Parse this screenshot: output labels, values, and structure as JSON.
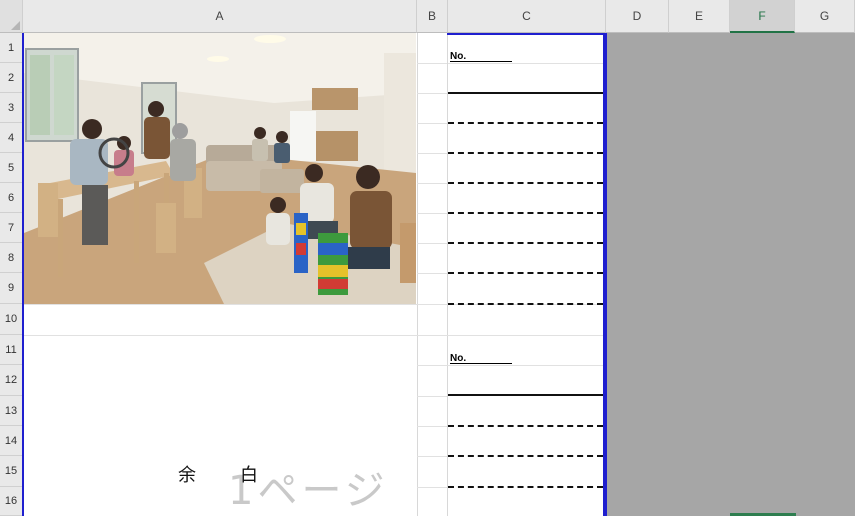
{
  "columns": [
    "A",
    "B",
    "C",
    "D",
    "E",
    "F",
    "G"
  ],
  "active_column": "F",
  "rows": [
    "1",
    "2",
    "3",
    "4",
    "5",
    "6",
    "7",
    "8",
    "9",
    "10",
    "11",
    "12",
    "13",
    "14",
    "15",
    "16"
  ],
  "form": {
    "no_label_1": "No.",
    "no_label_2": "No."
  },
  "blank_area": {
    "char1": "余",
    "char2": "白",
    "page_number_watermark": "1ページ"
  },
  "photo_icon": "family-room-photo",
  "colors": {
    "page_break": "#1f1fcf",
    "non_print_area": "#a6a6a6",
    "active_column_accent": "#217346"
  }
}
